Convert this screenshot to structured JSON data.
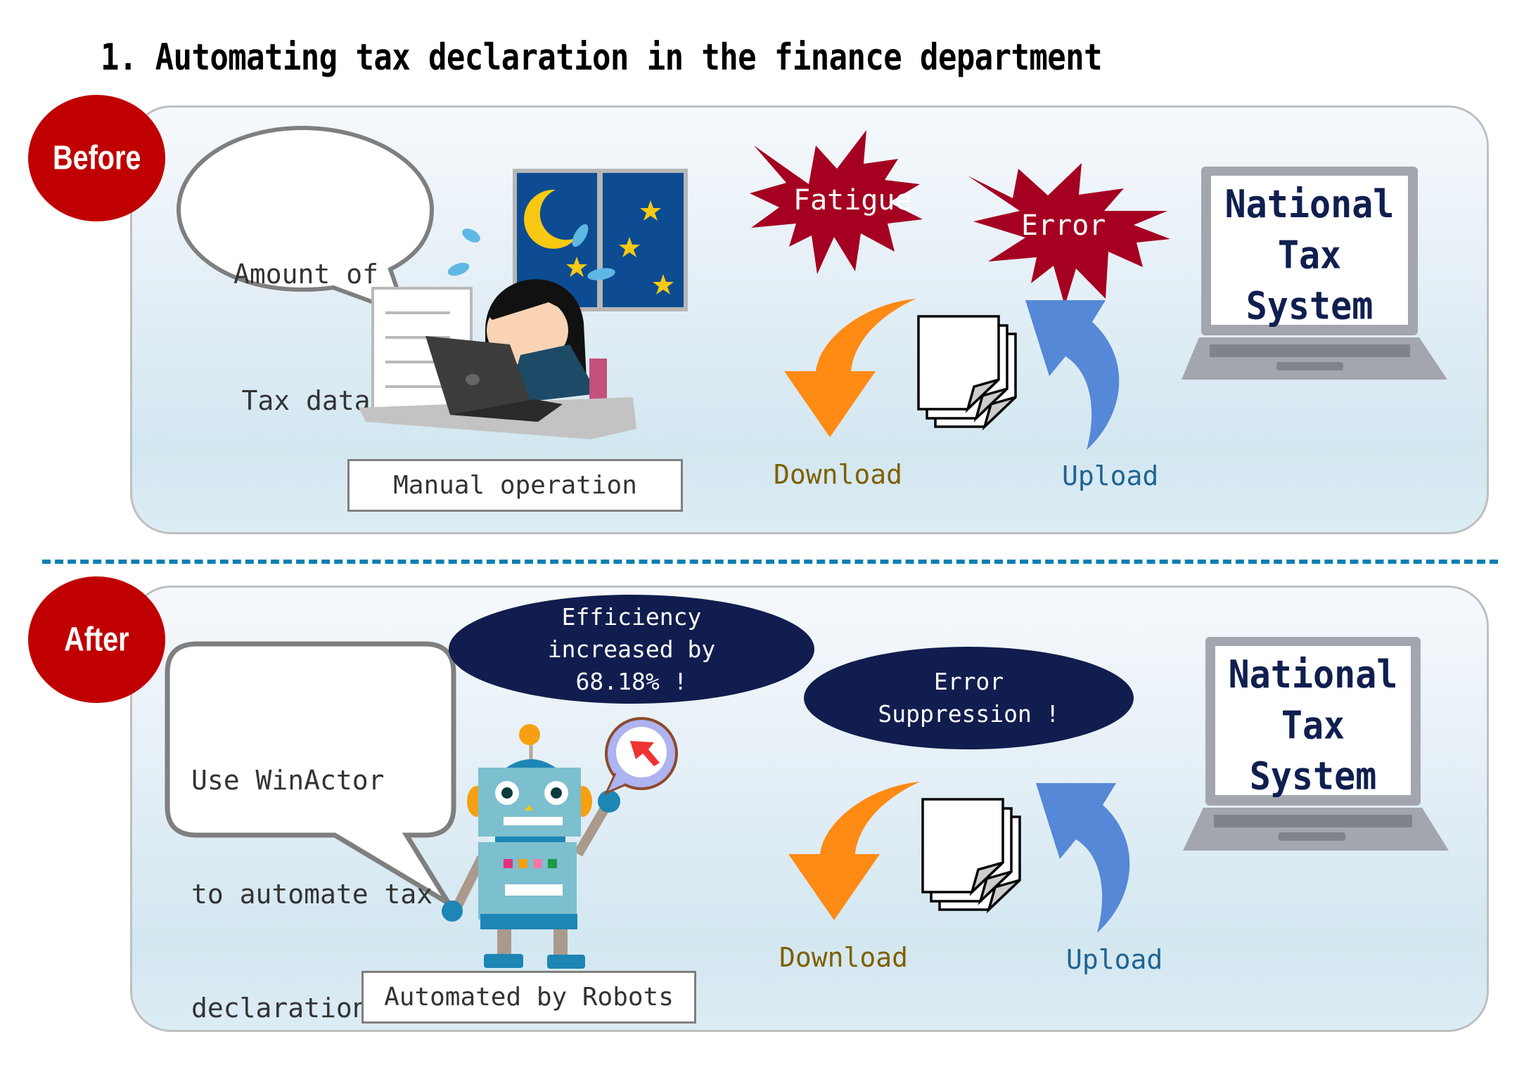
{
  "title": "1. Automating tax declaration in the finance department",
  "colors": {
    "badge_red": "#C00000",
    "burst_red": "#A50021",
    "oval_navy": "#111D4E",
    "download_text": "#7F6000",
    "upload_text": "#1F6391",
    "download_arrow": "#FF8A14",
    "upload_arrow": "#5588D6",
    "divider": "#0B7FB0"
  },
  "before": {
    "badge": "Before",
    "speech_bubble": [
      "Amount of",
      "Tax data"
    ],
    "illustration": "worker-at-night-icon",
    "label": "Manual operation",
    "bursts": [
      "Fatigue",
      "Error"
    ],
    "download_label": "Download",
    "upload_label": "Upload",
    "laptop_lines": [
      "National",
      "Tax",
      "System"
    ]
  },
  "after": {
    "badge": "After",
    "speech_bubble": [
      "Use WinActor",
      "to automate tax",
      "declarations"
    ],
    "illustration": "robot-icon",
    "label": "Automated by Robots",
    "ovals": [
      {
        "lines": [
          "Efficiency",
          "increased by",
          "68.18% !"
        ]
      },
      {
        "lines": [
          "Error",
          "Suppression !"
        ]
      }
    ],
    "download_label": "Download",
    "upload_label": "Upload",
    "laptop_lines": [
      "National",
      "Tax",
      "System"
    ]
  }
}
